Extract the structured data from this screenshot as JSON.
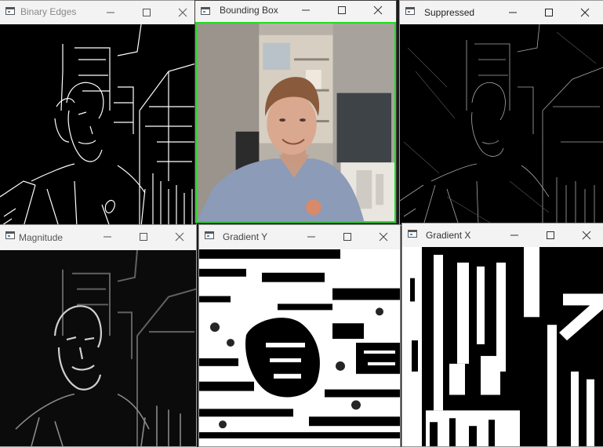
{
  "windows": {
    "binary_edges": {
      "title": "Binary Edges"
    },
    "bounding_box": {
      "title": "Bounding Box"
    },
    "suppressed": {
      "title": "Suppressed"
    },
    "magnitude": {
      "title": "Magnitude"
    },
    "gradient_y": {
      "title": "Gradient Y"
    },
    "gradient_x": {
      "title": "Gradient X"
    }
  },
  "icons": [
    "app-icon",
    "minimize-icon",
    "maximize-icon",
    "close-icon"
  ],
  "colors": {
    "bounding_box_outline": "#22dd22",
    "titlebar": "#f3f3f3"
  }
}
